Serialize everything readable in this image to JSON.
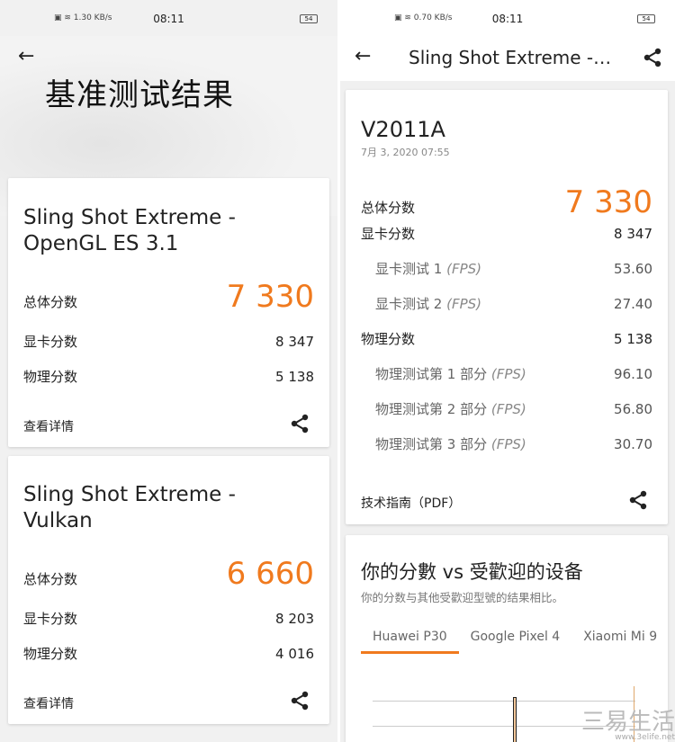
{
  "left": {
    "status": {
      "time": "08:11",
      "net": "1.30 KB/s",
      "battery": "54"
    },
    "title": "基准测试结果",
    "cards": [
      {
        "title1": "Sling Shot Extreme -",
        "title2": "OpenGL ES 3.1",
        "overall_label": "总体分数",
        "overall": "7 330",
        "gpu_label": "显卡分数",
        "gpu": "8 347",
        "phys_label": "物理分数",
        "phys": "5 138",
        "link": "查看详情"
      },
      {
        "title1": "Sling Shot Extreme -",
        "title2": "Vulkan",
        "overall_label": "总体分数",
        "overall": "6 660",
        "gpu_label": "显卡分数",
        "gpu": "8 203",
        "phys_label": "物理分数",
        "phys": "4 016",
        "link": "查看详情"
      }
    ]
  },
  "right": {
    "status": {
      "time": "08:11",
      "net": "0.70 KB/s",
      "battery": "54"
    },
    "title": "Sling Shot Extreme -…",
    "device": "V2011A",
    "date": "7月 3, 2020 07:55",
    "rows": [
      {
        "label": "总体分数",
        "value": "7 330"
      },
      {
        "label": "显卡分数",
        "value": "8 347"
      },
      {
        "label": "显卡测试 1",
        "unit": "(FPS)",
        "value": "53.60"
      },
      {
        "label": "显卡测试 2",
        "unit": "(FPS)",
        "value": "27.40"
      },
      {
        "label": "物理分数",
        "value": "5 138"
      },
      {
        "label": "物理测试第 1 部分",
        "unit": "(FPS)",
        "value": "96.10"
      },
      {
        "label": "物理测试第 2 部分",
        "unit": "(FPS)",
        "value": "56.80"
      },
      {
        "label": "物理测试第 3 部分",
        "unit": "(FPS)",
        "value": "30.70"
      }
    ],
    "link": "技术指南（PDF）",
    "compare": {
      "title": "你的分數 vs 受歡迎的设备",
      "subtitle": "你的分数与其他受歡迎型號的结果相比。",
      "tabs": [
        "Huawei P30",
        "Google Pixel 4",
        "Xiaomi Mi 9"
      ]
    }
  },
  "watermark": {
    "text": "三易生活",
    "url": "www.3elife.net"
  },
  "accent": "#f07a1e"
}
